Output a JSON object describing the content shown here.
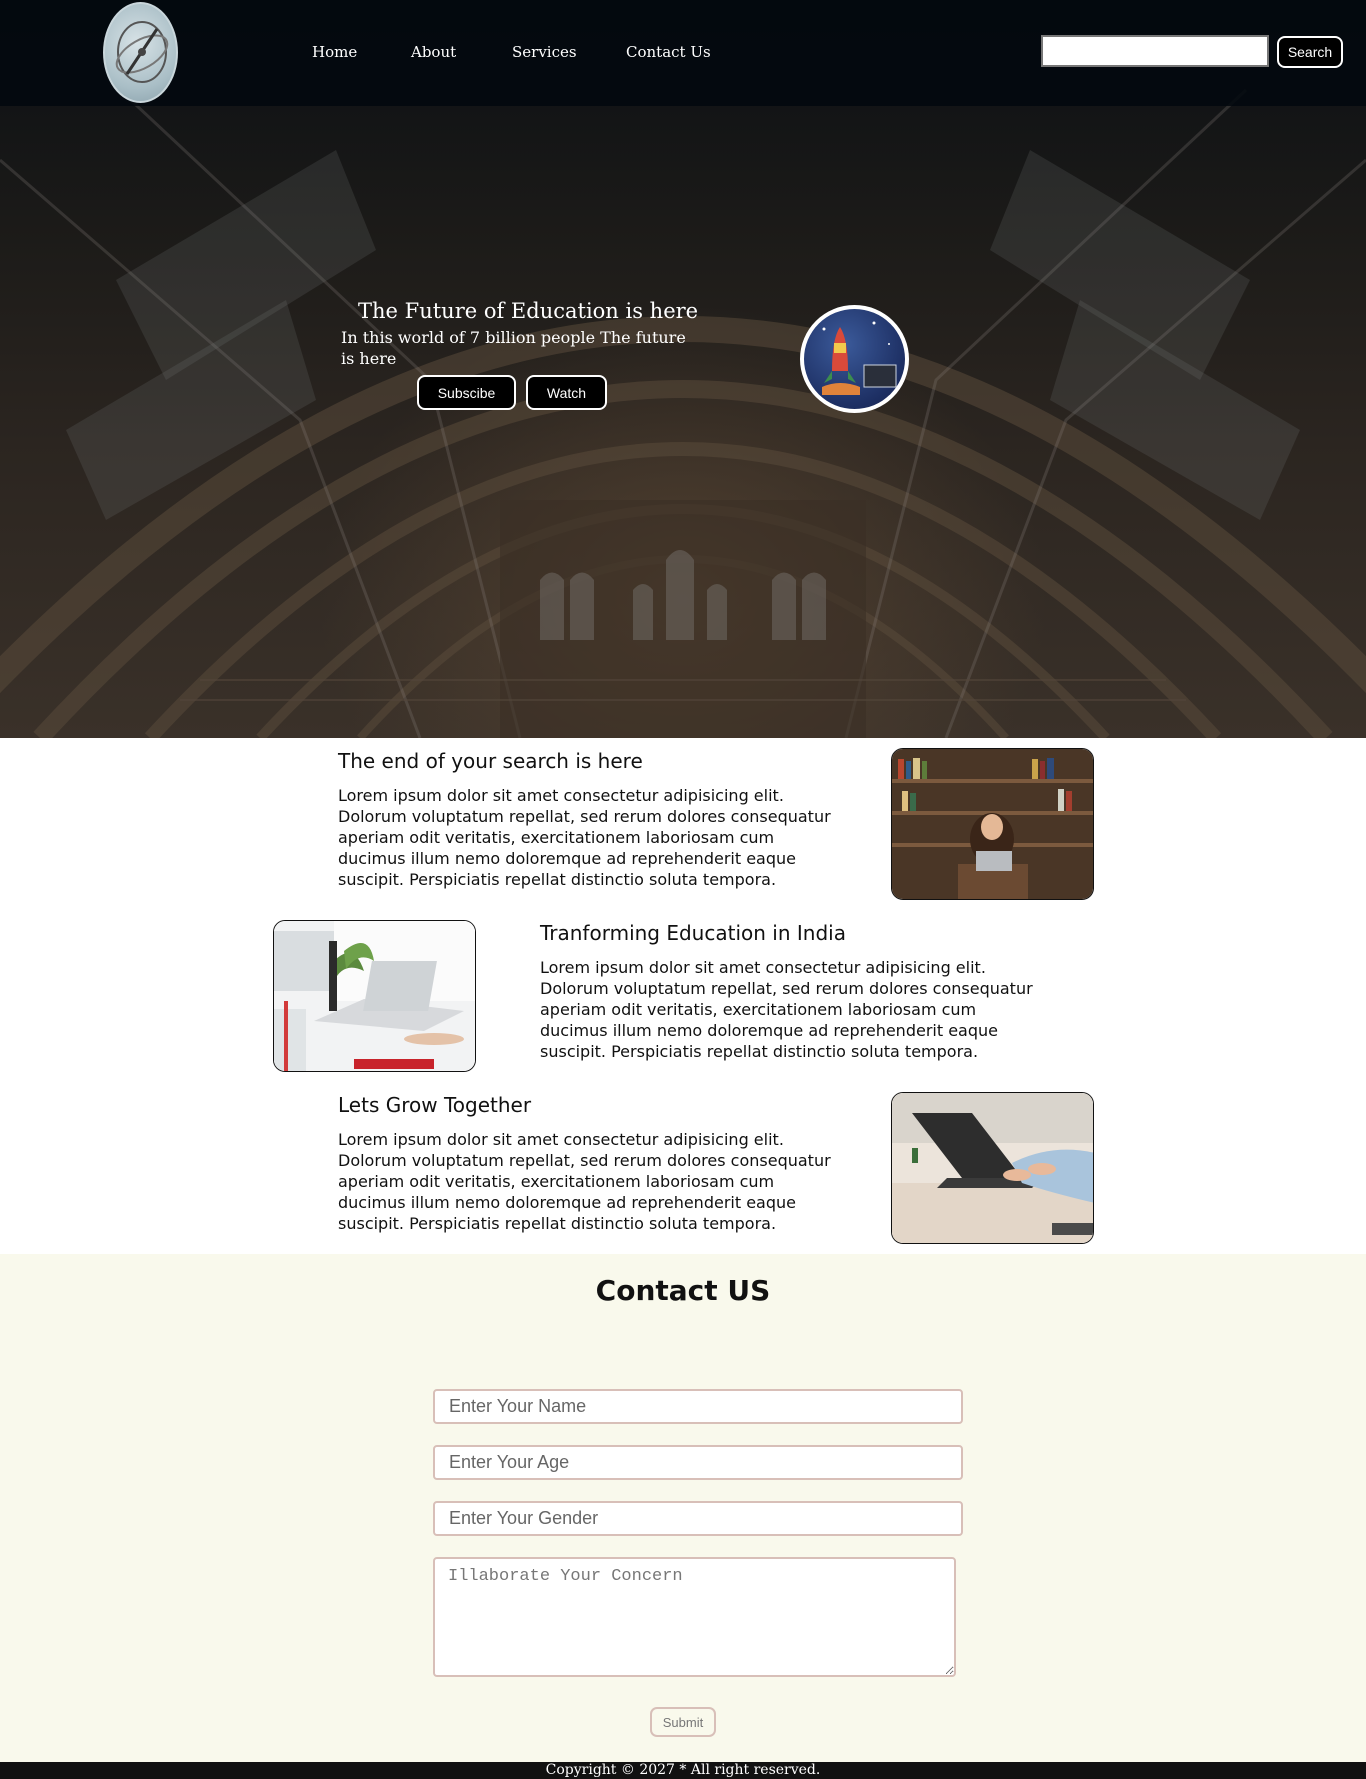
{
  "nav": {
    "links": [
      "Home",
      "About",
      "Services",
      "Contact Us"
    ],
    "search_button": "Search"
  },
  "hero": {
    "title": "The Future of Education is here",
    "subtitle": "In this world of 7 billion people The future is here",
    "subscribe_label": "Subscibe",
    "watch_label": "Watch"
  },
  "features": [
    {
      "heading": "The end of your search is here",
      "body": "Lorem ipsum dolor sit amet consectetur adipisicing elit. Dolorum voluptatum repellat, sed rerum dolores consequatur aperiam odit veritatis, exercitationem laboriosam cum ducimus illum nemo doloremque ad reprehenderit eaque suscipit. Perspiciatis repellat distinctio soluta tempora."
    },
    {
      "heading": "Tranforming Education in India",
      "body": "Lorem ipsum dolor sit amet consectetur adipisicing elit. Dolorum voluptatum repellat, sed rerum dolores consequatur aperiam odit veritatis, exercitationem laboriosam cum ducimus illum nemo doloremque ad reprehenderit eaque suscipit. Perspiciatis repellat distinctio soluta tempora."
    },
    {
      "heading": "Lets Grow Together",
      "body": "Lorem ipsum dolor sit amet consectetur adipisicing elit. Dolorum voluptatum repellat, sed rerum dolores consequatur aperiam odit veritatis, exercitationem laboriosam cum ducimus illum nemo doloremque ad reprehenderit eaque suscipit. Perspiciatis repellat distinctio soluta tempora."
    }
  ],
  "contact": {
    "title": "Contact US",
    "name_placeholder": "Enter Your Name",
    "age_placeholder": "Enter Your Age",
    "gender_placeholder": "Enter Your Gender",
    "concern_placeholder": "Illaborate Your Concern",
    "submit_label": "Submit"
  },
  "footer": {
    "copyright": "Copyright © 2027 * All right reserved."
  },
  "colors": {
    "nav_background": "#02080e",
    "contact_background": "#f9f9ec",
    "input_border": "#d8bfb8",
    "footer_background": "#111111"
  }
}
